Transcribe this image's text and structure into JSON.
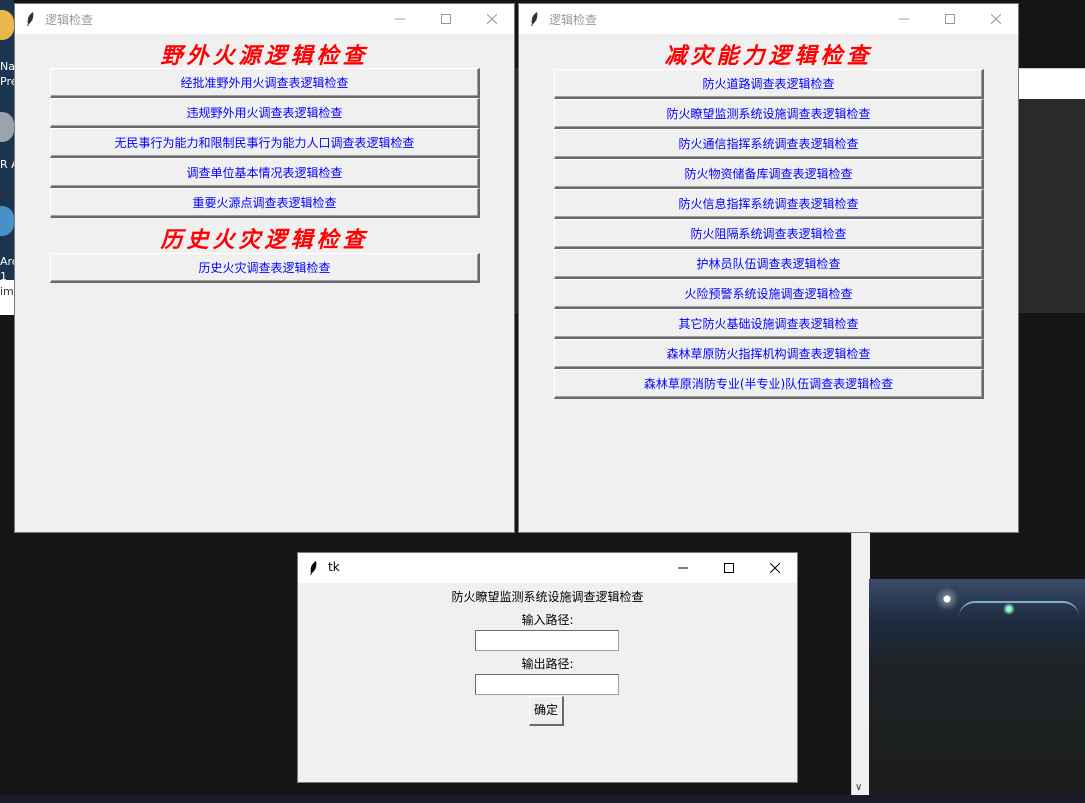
{
  "desktop": {
    "icon_labels": [
      "Na",
      "Pre",
      "R A",
      "Arc",
      "1",
      "im"
    ]
  },
  "window_left": {
    "title": "逻辑检查",
    "section1_heading": "野外火源逻辑检查",
    "section1_buttons": [
      "经批准野外用火调查表逻辑检查",
      "违规野外用火调查表逻辑检查",
      "无民事行为能力和限制民事行为能力人口调查表逻辑检查",
      "调查单位基本情况表逻辑检查",
      "重要火源点调查表逻辑检查"
    ],
    "section2_heading": "历史火灾逻辑检查",
    "section2_buttons": [
      "历史火灾调查表逻辑检查"
    ]
  },
  "window_right": {
    "title": "逻辑检查",
    "heading": "减灾能力逻辑检查",
    "buttons": [
      "防火道路调查表逻辑检查",
      "防火瞭望监测系统设施调查表逻辑检查",
      "防火通信指挥系统调查表逻辑检查",
      "防火物资储备库调查表逻辑检查",
      "防火信息指挥系统调查表逻辑检查",
      "防火阻隔系统调查表逻辑检查",
      "护林员队伍调查表逻辑检查",
      "火险预警系统设施调查逻辑检查",
      "其它防火基础设施调查表逻辑检查",
      "森林草原防火指挥机构调查表逻辑检查",
      "森林草原消防专业(半专业)队伍调查表逻辑检查"
    ]
  },
  "window_dialog": {
    "title": "tk",
    "heading": "防火瞭望监测系统设施调查逻辑检查",
    "input_label": "输入路径:",
    "input_value": "",
    "output_label": "输出路径:",
    "output_value": "",
    "confirm_label": "确定"
  },
  "icons": {
    "app": "feather-icon",
    "minimize": "minimize-icon",
    "maximize": "maximize-icon",
    "close": "close-icon",
    "scroll_down": "chevron-down-icon"
  },
  "colors": {
    "heading": "#ff0000",
    "button_text": "#0000ff",
    "window_bg": "#f0f0f0"
  }
}
